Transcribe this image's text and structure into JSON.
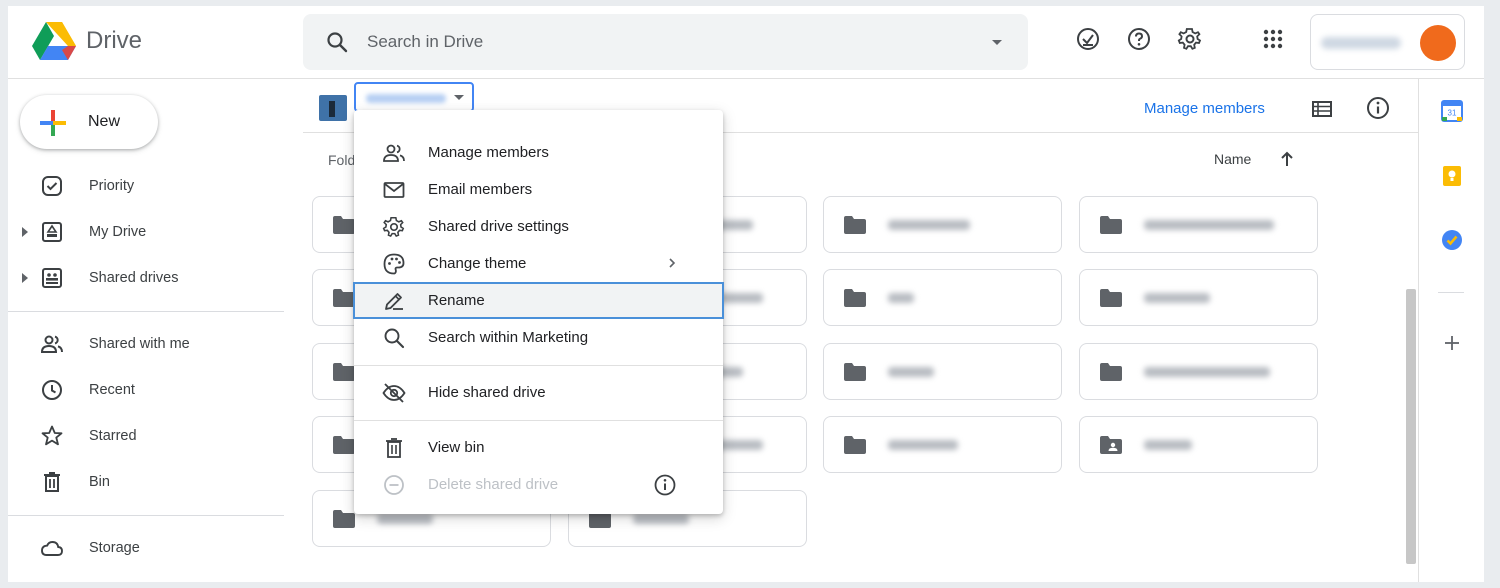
{
  "app": {
    "title": "Drive"
  },
  "search": {
    "placeholder": "Search in Drive"
  },
  "sidebar": {
    "new_label": "New",
    "items": [
      {
        "label": "Priority"
      },
      {
        "label": "My Drive"
      },
      {
        "label": "Shared drives"
      },
      {
        "label": "Shared with me"
      },
      {
        "label": "Recent"
      },
      {
        "label": "Starred"
      },
      {
        "label": "Bin"
      },
      {
        "label": "Storage"
      }
    ]
  },
  "toolbar": {
    "manage_members": "Manage members",
    "folders_label": "Folders",
    "sort_label": "Name"
  },
  "menu": {
    "items": [
      {
        "label": "Manage members",
        "icon": "people-icon"
      },
      {
        "label": "Email members",
        "icon": "mail-icon"
      },
      {
        "label": "Shared drive settings",
        "icon": "gear-icon"
      },
      {
        "label": "Change theme",
        "icon": "palette-icon"
      },
      {
        "label": "Rename",
        "icon": "pencil-icon",
        "selected": true
      },
      {
        "label": "Search within Marketing",
        "icon": "search-icon"
      },
      {
        "label": "Hide shared drive",
        "icon": "eye-off-icon"
      },
      {
        "label": "View bin",
        "icon": "trash-icon"
      },
      {
        "label": "Delete shared drive",
        "icon": "minus-circle-icon",
        "disabled": true
      }
    ]
  },
  "colors": {
    "accent": "#1a73e8",
    "avatar": "#f06a1c",
    "selected_outline": "#4a90d9"
  }
}
